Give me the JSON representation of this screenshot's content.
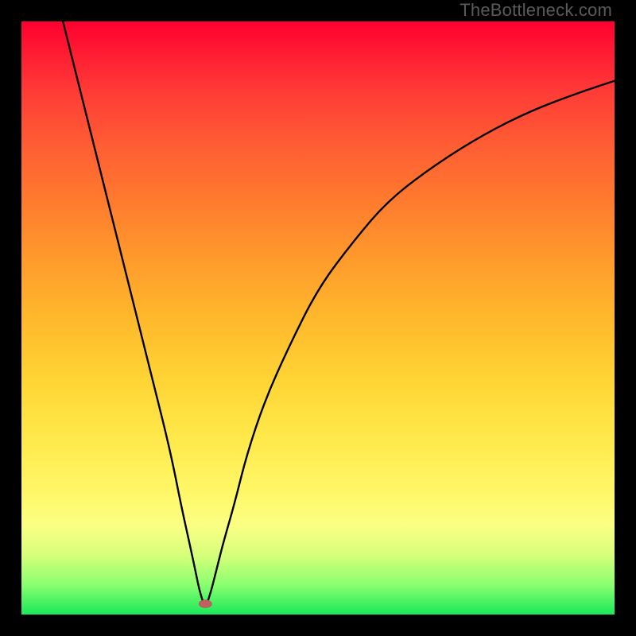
{
  "watermark": "TheBottleneck.com",
  "chart_data": {
    "type": "line",
    "title": "",
    "xlabel": "",
    "ylabel": "",
    "xlim": [
      0,
      100
    ],
    "ylim": [
      0,
      100
    ],
    "minimum_point": {
      "x": 31,
      "y": 99
    },
    "series": [
      {
        "name": "bottleneck-curve",
        "x": [
          7,
          10,
          14,
          18,
          22,
          25,
          27,
          29,
          30,
          31,
          32,
          33,
          34,
          36,
          38,
          41,
          45,
          50,
          56,
          62,
          70,
          78,
          86,
          94,
          100
        ],
        "values": [
          0,
          12,
          28,
          44,
          60,
          72,
          82,
          91,
          96,
          99,
          96,
          92,
          88,
          81,
          73,
          64,
          55,
          45,
          37,
          30,
          24,
          19,
          15,
          12,
          10
        ]
      }
    ],
    "colors": {
      "curve": "#000000",
      "gradient_top": "#ff0030",
      "gradient_bottom": "#19e85a",
      "dot": "#c06060"
    }
  }
}
